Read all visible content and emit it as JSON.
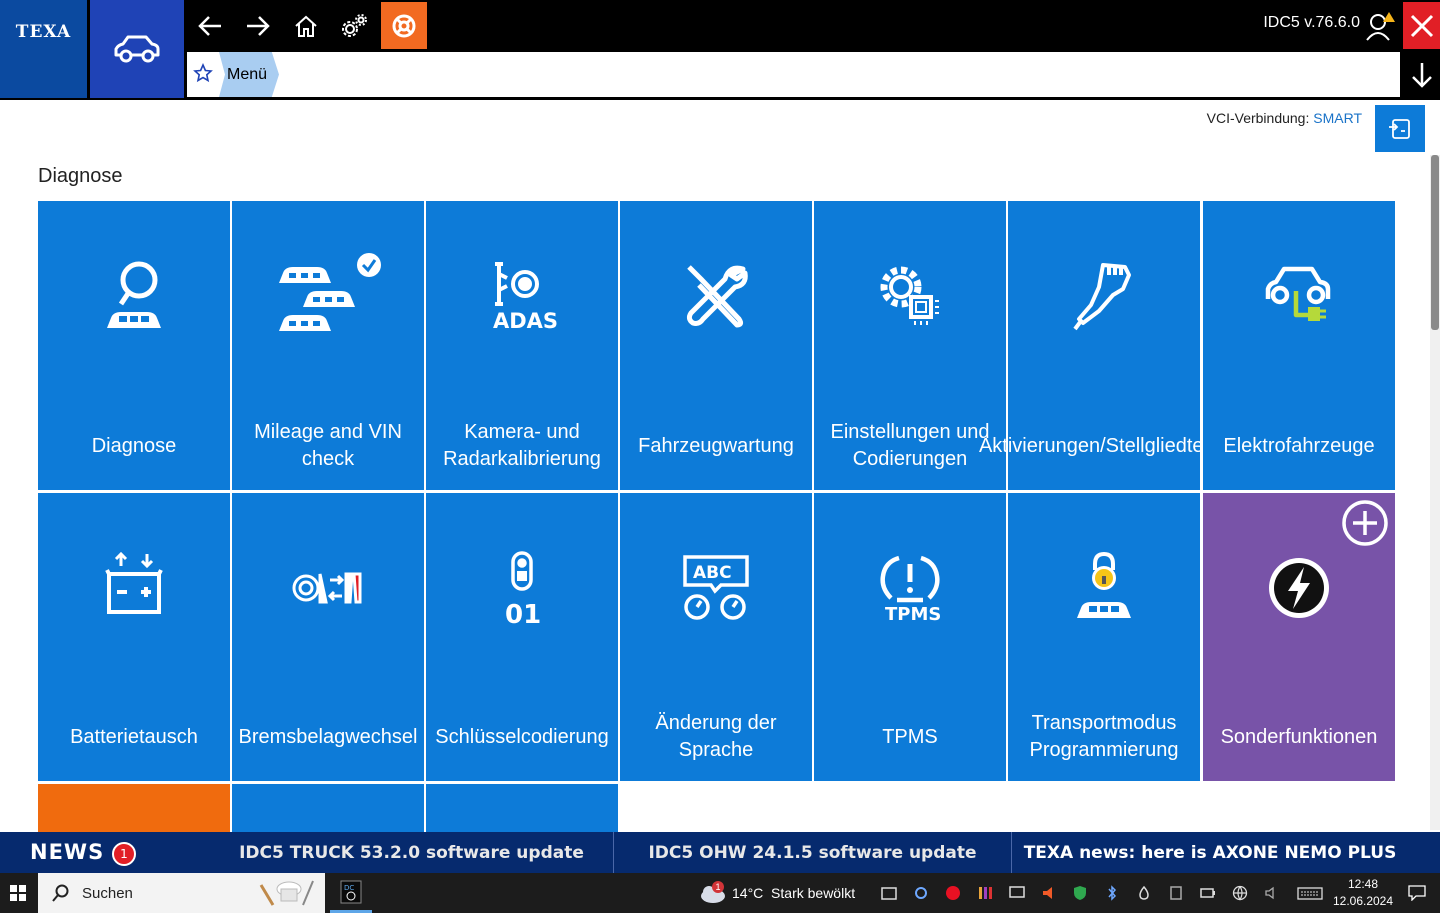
{
  "header": {
    "logo_text": "TEXA",
    "app_version": "IDC5 v.76.6.0",
    "breadcrumb": "Menü"
  },
  "vci": {
    "label": "VCI-Verbindung:",
    "value": "SMART"
  },
  "section_title": "Diagnose",
  "tiles": [
    {
      "label": "Diagnose",
      "icon": "car-search-icon"
    },
    {
      "label": "Mileage and VIN check",
      "icon": "cars-check-icon"
    },
    {
      "label": "Kamera- und Radarkalibrierung",
      "icon": "adas-icon",
      "icon_text": "ADAS"
    },
    {
      "label": "Fahrzeugwartung",
      "icon": "tools-icon"
    },
    {
      "label": "Einstellungen und Codierungen",
      "icon": "gear-chip-icon"
    },
    {
      "label": "Aktivierungen/Stellgliedtests",
      "icon": "actuator-icon"
    },
    {
      "label": "Elektrofahrzeuge",
      "icon": "electric-car-icon"
    },
    {
      "label": "Batterietausch",
      "icon": "battery-icon"
    },
    {
      "label": "Bremsbelagwechsel",
      "icon": "brake-pad-icon"
    },
    {
      "label": "Schlüsselcodierung",
      "icon": "key-icon",
      "icon_text": "01"
    },
    {
      "label": "Änderung der Sprache",
      "icon": "language-icon",
      "icon_text": "ABC"
    },
    {
      "label": "TPMS",
      "icon": "tpms-icon",
      "icon_text": "TPMS"
    },
    {
      "label": "Transportmodus Programmierung",
      "icon": "transport-lock-icon"
    },
    {
      "label": "Sonderfunktionen",
      "icon": "lightning-icon"
    }
  ],
  "news": {
    "title": "NEWS",
    "count": "1",
    "items": [
      "IDC5 TRUCK 53.2.0 software update",
      "IDC5 OHW 24.1.5 software update",
      "TEXA news: here is AXONE NEMO PLUS"
    ]
  },
  "taskbar": {
    "search_placeholder": "Suchen",
    "weather": "14°C  Stark bewölkt",
    "weather_badge": "1",
    "time": "12:48",
    "date": "12.06.2024"
  },
  "colors": {
    "tile_blue": "#0d7bd8",
    "tile_purple": "#7853a8",
    "tile_orange": "#f06b0e",
    "news_bg": "#062a6e",
    "close_red": "#e11f26",
    "accent_orange": "#f26a21"
  }
}
